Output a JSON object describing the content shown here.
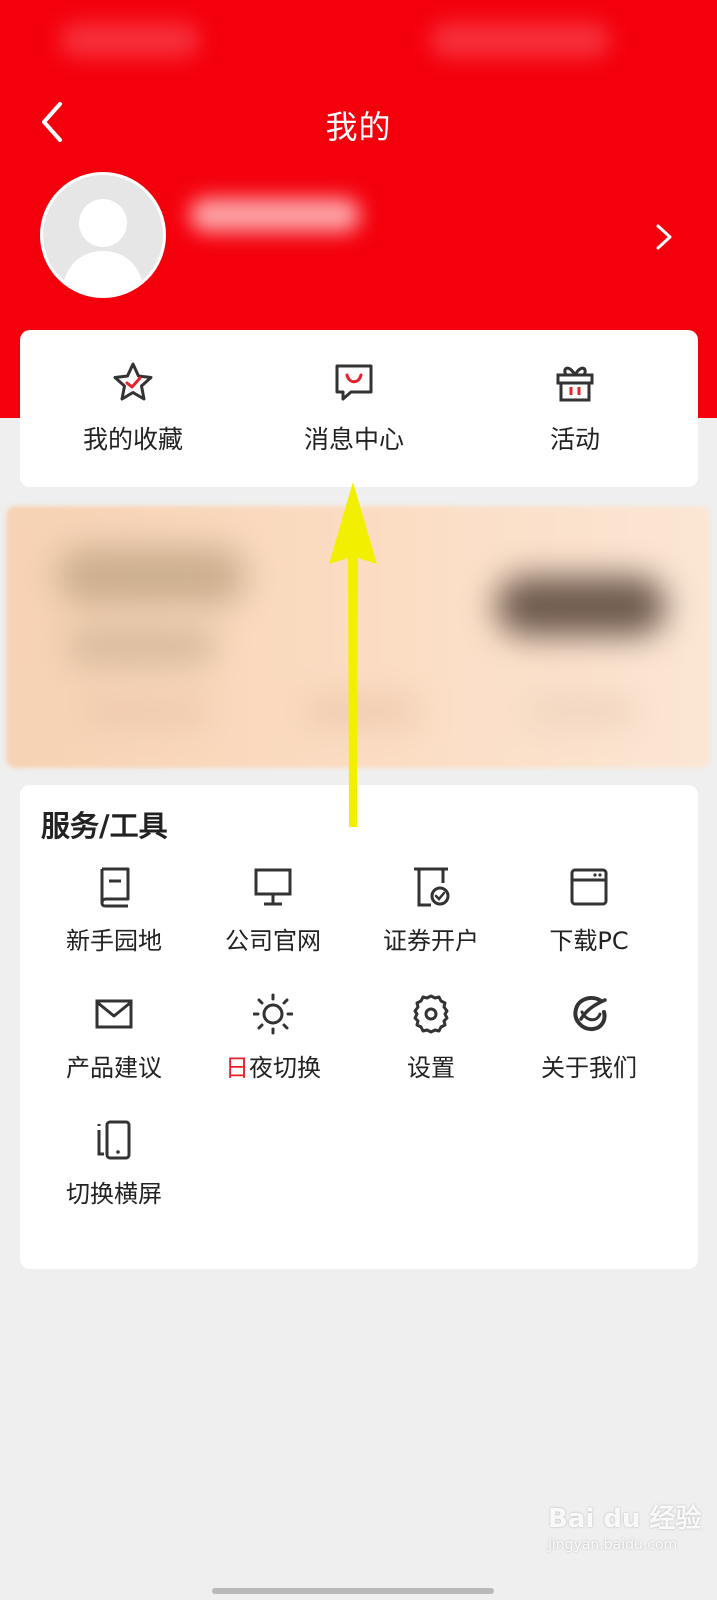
{
  "header": {
    "title": "我的",
    "bg_color": "#f4000d"
  },
  "quick_actions": [
    {
      "label": "我的收藏",
      "icon": "star-icon"
    },
    {
      "label": "消息中心",
      "icon": "message-icon"
    },
    {
      "label": "活动",
      "icon": "gift-icon"
    }
  ],
  "tools": {
    "title": "服务/工具",
    "items": [
      {
        "label": "新手园地",
        "icon": "book-icon"
      },
      {
        "label": "公司官网",
        "icon": "monitor-icon"
      },
      {
        "label": "证券开户",
        "icon": "account-open-icon"
      },
      {
        "label": "下载PC",
        "icon": "window-icon"
      },
      {
        "label": "产品建议",
        "icon": "mail-icon"
      },
      {
        "label_accent": "日",
        "label_rest": "夜切换",
        "icon": "sun-icon"
      },
      {
        "label": "设置",
        "icon": "gear-icon"
      },
      {
        "label": "关于我们",
        "icon": "brand-logo-icon"
      },
      {
        "label": "切换横屏",
        "icon": "rotate-screen-icon"
      }
    ]
  },
  "watermark": {
    "text": "Bai du 经验",
    "sub": "jingyan.baidu.com"
  },
  "colors": {
    "accent_red": "#e5232b",
    "annotation_arrow": "#f2f000"
  }
}
